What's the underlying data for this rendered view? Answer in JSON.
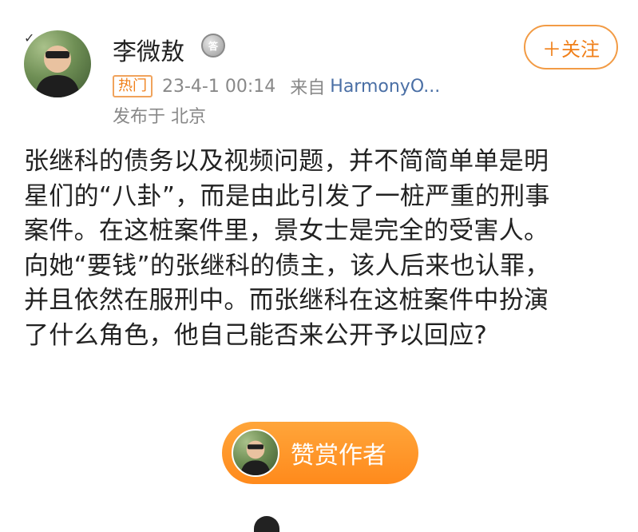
{
  "user": {
    "name": "李微敖",
    "medal_icon": "medal-icon",
    "verified_icon": "verified-badge-icon",
    "follow_label": "＋关注"
  },
  "meta": {
    "hot_label": "热门",
    "time": "23-4-1 00:14",
    "source_prefix": "来自",
    "source": "HarmonyO...",
    "location": "发布于 北京"
  },
  "post": {
    "lines": [
      "张继科的债务以及视频问题，并不简简单单是明",
      "星们的“八卦”，而是由此引发了一桩严重的刑事",
      "案件。在这桩案件里，景女士是完全的受害人。",
      "向她“要钱”的张继科的债主，该人后来也认罪，",
      "并且依然在服刑中。而张继科在这桩案件中扮演",
      "了什么角色，他自己能否来公开予以回应?"
    ]
  },
  "reward": {
    "label": "赞赏作者"
  },
  "colors": {
    "accent": "#f07f18",
    "link": "#4a6fa5",
    "reward_bg": "#ff9a2e"
  }
}
